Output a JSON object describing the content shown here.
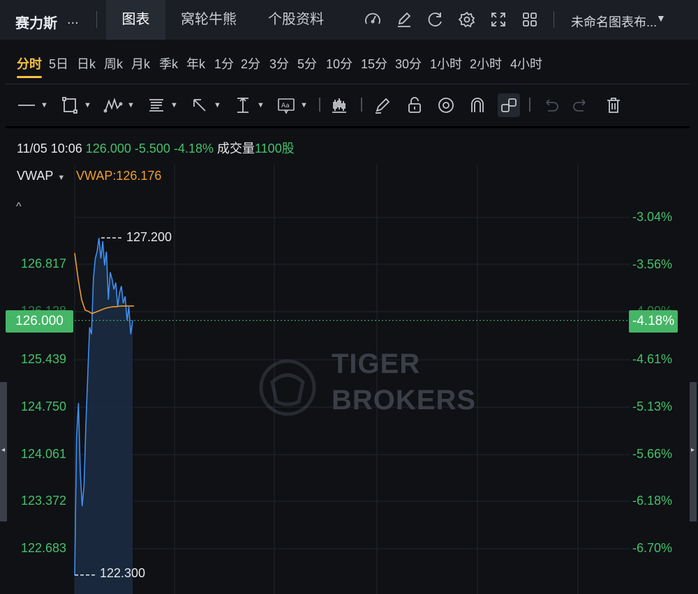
{
  "header": {
    "stock_name": "赛力斯",
    "stock_more": "...",
    "tabs": [
      {
        "label": "图表",
        "active": true
      },
      {
        "label": "窝轮牛熊",
        "active": false
      },
      {
        "label": "个股资料",
        "active": false
      }
    ],
    "icons": [
      "gauge-icon",
      "pencil-icon",
      "refresh-icon",
      "gear-icon",
      "fullscreen-icon",
      "grid-icon"
    ],
    "layout_name": "未命名图表布...",
    "layout_caret": "▼"
  },
  "periods": [
    {
      "label": "分时",
      "active": true
    },
    {
      "label": "5日"
    },
    {
      "label": "日k"
    },
    {
      "label": "周k"
    },
    {
      "label": "月k"
    },
    {
      "label": "季k"
    },
    {
      "label": "年k"
    },
    {
      "label": "1分"
    },
    {
      "label": "2分"
    },
    {
      "label": "3分"
    },
    {
      "label": "5分"
    },
    {
      "label": "10分"
    },
    {
      "label": "15分"
    },
    {
      "label": "30分"
    },
    {
      "label": "1小时"
    },
    {
      "label": "2小时"
    },
    {
      "label": "4小时"
    }
  ],
  "tools": [
    "line-tool-icon",
    "rectangle-tool-icon",
    "pattern-tool-icon",
    "fibonacci-tool-icon",
    "arrow-tool-icon",
    "measure-tool-icon",
    "text-tool-icon",
    "candle-tool-icon",
    "brush-tool-icon",
    "lock-icon",
    "eye-icon",
    "magnet-icon",
    "link-icon",
    "undo-icon",
    "redo-icon",
    "trash-icon"
  ],
  "info": {
    "datetime": "11/05 10:06",
    "price": "126.000",
    "change": "-5.500",
    "change_pct": "-4.18%",
    "volume_label": "成交量",
    "volume": "1100股"
  },
  "indicator": {
    "name": "VWAP",
    "caret": "▼",
    "value_text": "VWAP:126.176",
    "collapse": "^"
  },
  "chart_data": {
    "type": "line",
    "y_left_ticks": [
      "126.817",
      "125.439",
      "124.750",
      "124.061",
      "123.372",
      "122.683"
    ],
    "y_left_hidden": "126.128",
    "y_right_ticks": [
      "-3.04%",
      "-3.56%",
      "-4.61%",
      "-5.13%",
      "-5.66%",
      "-6.18%",
      "-6.70%"
    ],
    "y_right_hidden": "-4.09%",
    "current_price": "126.000",
    "current_pct": "-4.18%",
    "high_label": "127.200",
    "low_label": "122.300",
    "ylim": [
      122.18,
      127.63
    ],
    "price_series": [
      122.3,
      124.3,
      124.8,
      123.8,
      123.3,
      123.6,
      124.5,
      125.2,
      125.9,
      125.8,
      126.6,
      126.9,
      127.0,
      127.2,
      126.9,
      127.15,
      126.8,
      127.0,
      126.3,
      126.7,
      126.6,
      126.45,
      126.55,
      126.2,
      126.4,
      126.5,
      126.25,
      126.35,
      126.0,
      126.2,
      125.8,
      126.0
    ],
    "vwap_series": [
      126.98,
      126.6,
      126.3,
      126.15,
      126.13,
      126.1,
      126.12,
      126.14,
      126.16,
      126.18,
      126.19,
      126.2,
      126.2,
      126.21,
      126.21,
      126.21,
      126.21,
      126.21
    ],
    "colors": {
      "price": "#3f8ef0",
      "vwap": "#f09e2a",
      "up": "#45c06a",
      "area": "#1b2b40"
    }
  },
  "watermark": {
    "line1": "TIGER",
    "line2": "BROKERS"
  }
}
